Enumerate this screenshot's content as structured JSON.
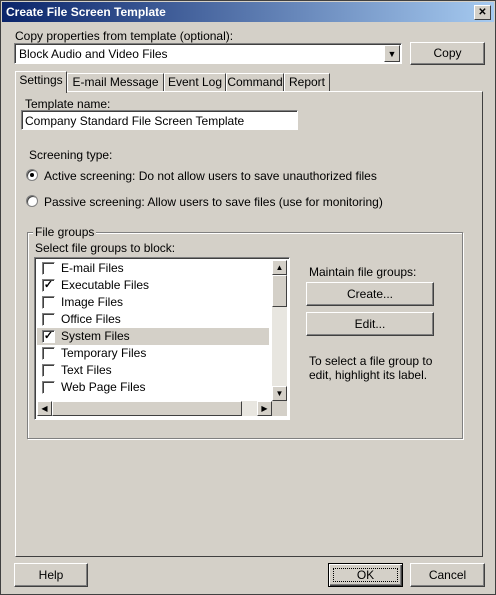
{
  "window": {
    "title": "Create File Screen Template",
    "close_glyph": "✕"
  },
  "copy_from": {
    "label": "Copy properties from template (optional):",
    "selected": "Block Audio and Video Files",
    "copy_button": "Copy"
  },
  "tabs": [
    {
      "label": "Settings"
    },
    {
      "label": "E-mail Message"
    },
    {
      "label": "Event Log"
    },
    {
      "label": "Command"
    },
    {
      "label": "Report"
    }
  ],
  "settings": {
    "template_name_label": "Template name:",
    "template_name_value": "Company Standard File Screen Template",
    "screening_type_label": "Screening type:",
    "active_screening": "Active screening: Do not allow users to save unauthorized files",
    "passive_screening": "Passive screening: Allow users to save files (use for monitoring)",
    "screening_selected": "active"
  },
  "file_groups": {
    "group_label": "File groups",
    "select_label": "Select file groups to block:",
    "items": [
      {
        "label": "E-mail Files",
        "checked": false,
        "mark": ""
      },
      {
        "label": "Executable Files",
        "checked": true,
        "mark": "✓"
      },
      {
        "label": "Image Files",
        "checked": false,
        "mark": ""
      },
      {
        "label": "Office Files",
        "checked": false,
        "mark": ""
      },
      {
        "label": "System Files",
        "checked": true,
        "mark": "✓"
      },
      {
        "label": "Temporary Files",
        "checked": false,
        "mark": ""
      },
      {
        "label": "Text Files",
        "checked": false,
        "mark": ""
      },
      {
        "label": "Web Page Files",
        "checked": false,
        "mark": ""
      }
    ],
    "selected_index": 4,
    "maintain_label": "Maintain file groups:",
    "create_button": "Create...",
    "edit_button": "Edit...",
    "hint": "To select a file group to edit, highlight its label."
  },
  "footer": {
    "help": "Help",
    "ok": "OK",
    "cancel": "Cancel"
  }
}
